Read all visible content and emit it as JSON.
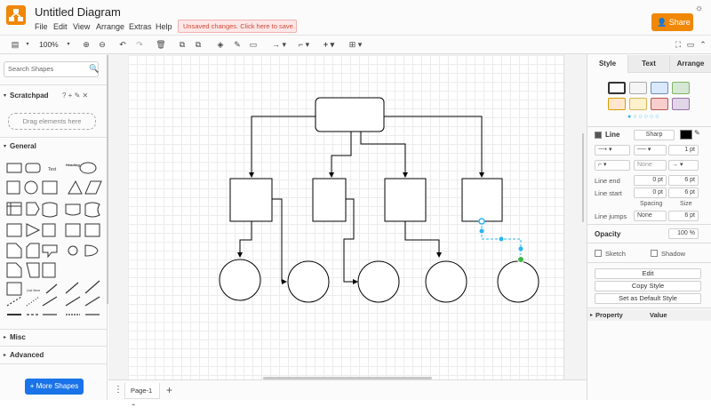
{
  "app": {
    "title": "Untitled Diagram",
    "unsaved": "Unsaved changes. Click here to save.",
    "share": "Share"
  },
  "menu": [
    "File",
    "Edit",
    "View",
    "Arrange",
    "Extras",
    "Help"
  ],
  "toolbar": {
    "zoom": "100%"
  },
  "left": {
    "search_placeholder": "Search Shapes",
    "scratchpad": "Scratchpad",
    "drag": "Drag elements here",
    "general": "General",
    "misc": "Misc",
    "advanced": "Advanced",
    "more_shapes": "+ More Shapes",
    "text_shape": "Text",
    "heading_shape": "Heading",
    "list_shape": "List Item"
  },
  "bottom": {
    "page": "Page-1"
  },
  "right": {
    "tabs": [
      "Style",
      "Text",
      "Arrange"
    ],
    "swatches": [
      "#ffffff",
      "#f5f5f5",
      "#dae8fc",
      "#d5e8d4",
      "#ffe6cc",
      "#fff2cc",
      "#f8cecc",
      "#e1d5e7"
    ],
    "line_label": "Line",
    "line_style": "Sharp",
    "line_color": "#000000",
    "line_width": "1 pt",
    "none": "None",
    "line_end": "Line end",
    "line_start": "Line start",
    "end_val": "0 pt",
    "end_size": "6 pt",
    "start_val": "0 pt",
    "start_size": "6 pt",
    "spacing": "Spacing",
    "size": "Size",
    "line_jumps": "Line jumps",
    "jumps_val": "None",
    "jumps_size": "6 pt",
    "opacity": "Opacity",
    "opacity_val": "100 %",
    "sketch": "Sketch",
    "shadow": "Shadow",
    "edit": "Edit",
    "copy_style": "Copy Style",
    "set_default": "Set as Default Style",
    "property": "Property",
    "value": "Value"
  }
}
